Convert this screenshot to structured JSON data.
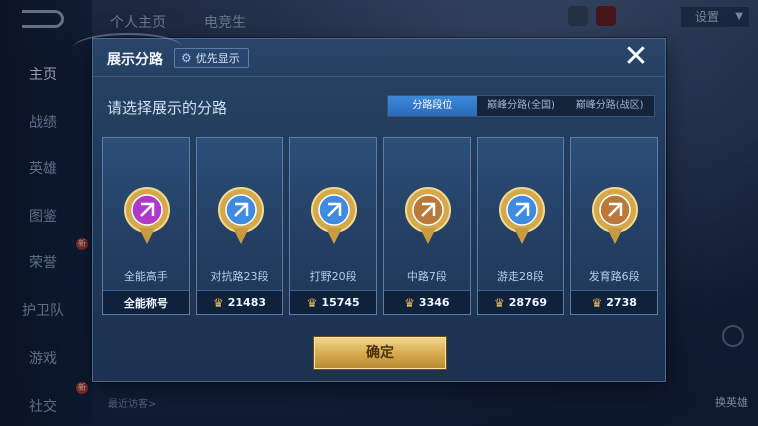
{
  "background": {
    "nav_items": [
      {
        "label": "主页",
        "active": true,
        "badge": ""
      },
      {
        "label": "战绩",
        "active": false,
        "badge": ""
      },
      {
        "label": "英雄",
        "active": false,
        "badge": ""
      },
      {
        "label": "图鉴",
        "active": false,
        "badge": ""
      },
      {
        "label": "荣誉",
        "active": false,
        "badge": "新"
      },
      {
        "label": "护卫队",
        "active": false,
        "badge": ""
      },
      {
        "label": "游戏",
        "active": false,
        "badge": ""
      },
      {
        "label": "社交",
        "active": false,
        "badge": "新"
      }
    ],
    "top_tabs": [
      "个人主页",
      "电竞生"
    ],
    "settings_label": "设置",
    "recent_visitors_label": "最近访客>",
    "swap_hero_label": "换英雄"
  },
  "dialog": {
    "title": "展示分路",
    "prefer_button": "优先显示",
    "prefer_icon": "gear-icon",
    "close_icon": "close-icon",
    "subtitle": "请选择展示的分路",
    "tabs": [
      {
        "label": "分路段位",
        "active": true
      },
      {
        "label": "巅峰分路(全国)",
        "active": false
      },
      {
        "label": "巅峰分路(战区)",
        "active": false
      }
    ],
    "cards": [
      {
        "name": "全能高手",
        "footer": "全能称号",
        "points": "",
        "emblem": "all-round-emblem",
        "color": "#b03ac8"
      },
      {
        "name": "对抗路23段",
        "footer": "21483",
        "points": "trophy",
        "emblem": "clash-lane-emblem",
        "color": "#3f8be0"
      },
      {
        "name": "打野20段",
        "footer": "15745",
        "points": "trophy",
        "emblem": "jungle-emblem",
        "color": "#3f8be0"
      },
      {
        "name": "中路7段",
        "footer": "3346",
        "points": "trophy",
        "emblem": "mid-lane-emblem",
        "color": "#b8793a"
      },
      {
        "name": "游走28段",
        "footer": "28769",
        "points": "trophy",
        "emblem": "roam-emblem",
        "color": "#3f8be0"
      },
      {
        "name": "发育路6段",
        "footer": "2738",
        "points": "trophy",
        "emblem": "farm-lane-emblem",
        "color": "#b8793a"
      }
    ],
    "confirm_label": "确定"
  },
  "colors": {
    "accent_blue": "#2a6bb8",
    "confirm_gold": "#d6a84b",
    "dialog_bg": "#203a5a"
  }
}
